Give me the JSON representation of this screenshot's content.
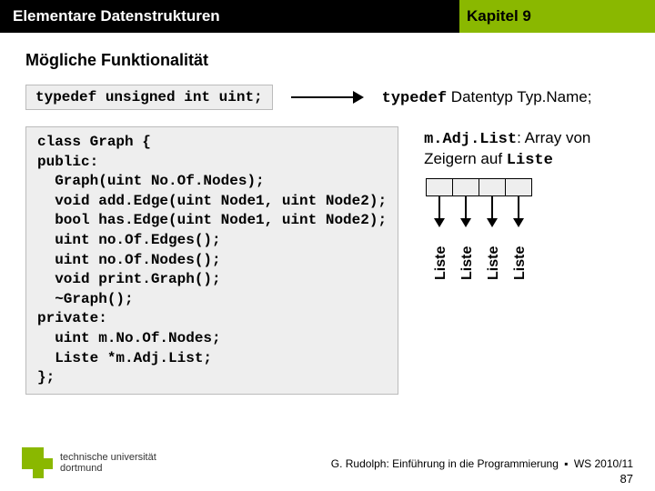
{
  "header": {
    "left": "Elementare Datenstrukturen",
    "right": "Kapitel 9"
  },
  "subtitle": "Mögliche Funktionalität",
  "typedef_box": "typedef unsigned int uint;",
  "typedef_expl": {
    "kw": "typedef",
    "rest": " Datentyp Typ.Name;"
  },
  "code": "class Graph {\npublic:\n  Graph(uint No.Of.Nodes);\n  void add.Edge(uint Node1, uint Node2);\n  bool has.Edge(uint Node1, uint Node2);\n  uint no.Of.Edges();\n  uint no.Of.Nodes();\n  void print.Graph();\n  ~Graph();\nprivate:\n  uint m.No.Of.Nodes;\n  Liste *m.Adj.List;\n};",
  "adj_desc": {
    "kw1": "m.Adj.List",
    "mid": ": Array von Zeigern auf ",
    "kw2": "Liste"
  },
  "liste_labels": [
    "Liste",
    "Liste",
    "Liste",
    "Liste"
  ],
  "footer": {
    "author": "G. Rudolph: Einführung in die Programmierung",
    "term": "WS 2010/11",
    "page": "87"
  },
  "logo": {
    "line1": "technische universität",
    "line2": "dortmund"
  }
}
